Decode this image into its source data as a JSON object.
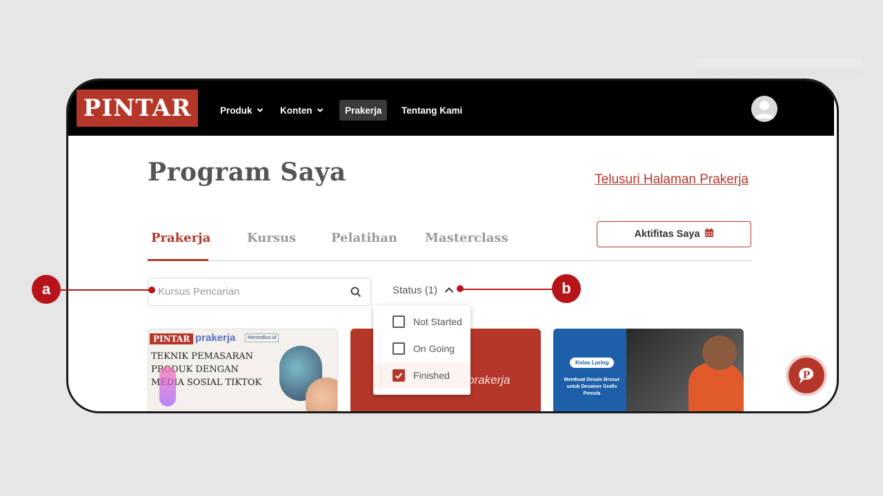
{
  "app": {
    "logo_text": "PINTAR"
  },
  "nav": {
    "items": [
      {
        "label": "Produk"
      },
      {
        "label": "Konten"
      },
      {
        "label": "Prakerja"
      },
      {
        "label": "Tentang Kami"
      }
    ]
  },
  "page": {
    "title": "Program Saya",
    "browse_link": "Telusuri Halaman Prakerja"
  },
  "tabs": [
    {
      "label": "Prakerja",
      "active": true
    },
    {
      "label": "Kursus"
    },
    {
      "label": "Pelatihan"
    },
    {
      "label": "Masterclass"
    }
  ],
  "activity_button": {
    "label": "Aktifitas Saya",
    "icon": "calendar-icon"
  },
  "search": {
    "placeholder": "Kursus Pencarian",
    "value": ""
  },
  "status_filter": {
    "label": "Status (1)",
    "expanded": true,
    "options": [
      {
        "label": "Not Started",
        "checked": false
      },
      {
        "label": "On Going",
        "checked": false
      },
      {
        "label": "Finished",
        "checked": true
      }
    ]
  },
  "cards": [
    {
      "brand_tag": "PINTAR",
      "partner_tag": "prakerja",
      "partner2_tag": "MentorBox.id",
      "title": "Teknik Pemasaran Produk dengan Media Sosial TikTok"
    },
    {
      "watermark": "prakerja"
    },
    {
      "badge": "Kelas Luring",
      "description": "Membuat Desain Brosur untuk Desainer Grafis Pemula"
    }
  ],
  "callouts": [
    {
      "label": "a"
    },
    {
      "label": "b"
    }
  ],
  "colors": {
    "brand_red": "#b5372a",
    "navbar": "#000000",
    "callout_red": "#b7141a"
  }
}
